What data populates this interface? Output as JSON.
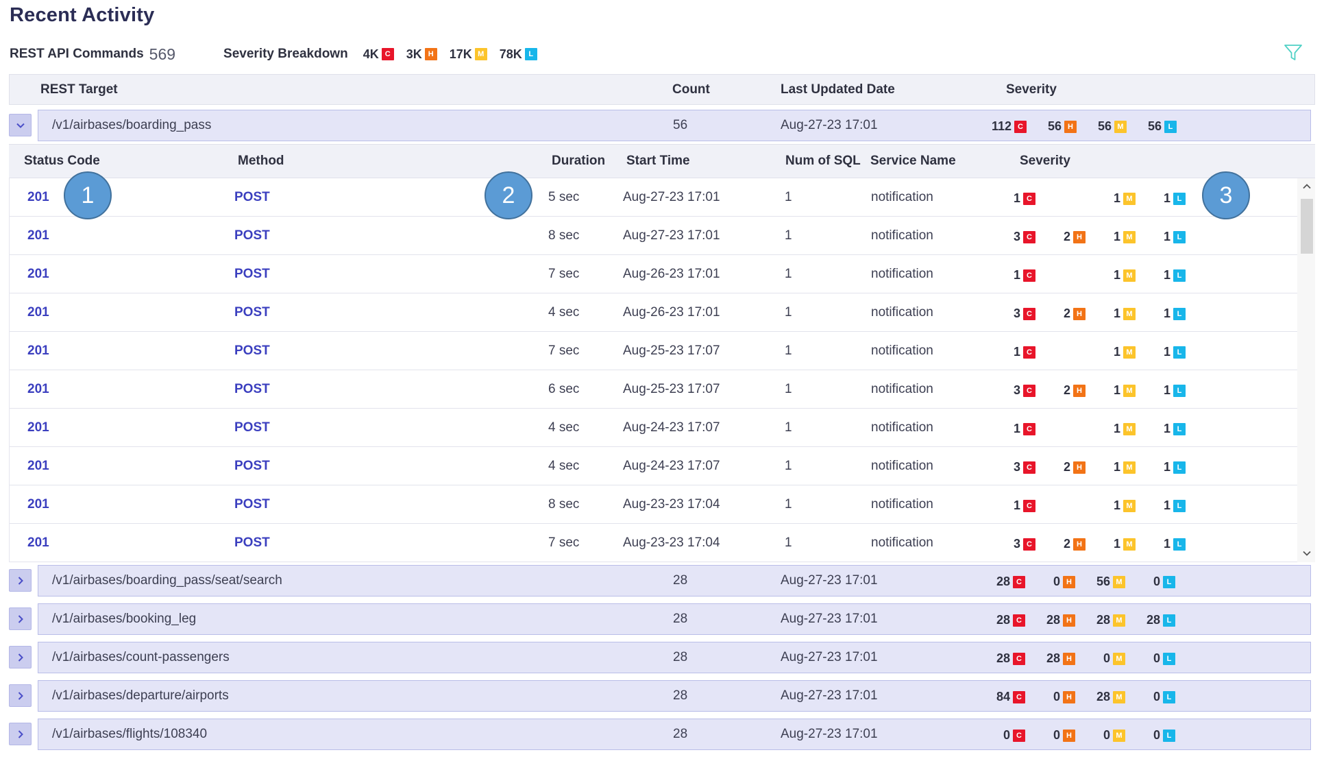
{
  "title": "Recent Activity",
  "summary": {
    "commands_label": "REST API Commands",
    "commands_value": "569",
    "breakdown_label": "Severity Breakdown",
    "breakdown": [
      {
        "value": "4K",
        "badge": "C"
      },
      {
        "value": "3K",
        "badge": "H"
      },
      {
        "value": "17K",
        "badge": "M"
      },
      {
        "value": "78K",
        "badge": "L"
      }
    ]
  },
  "colors": {
    "critical": "#e8152a",
    "high": "#f27316",
    "medium": "#fcc42b",
    "low": "#18b6ea",
    "header_bg": "#f0f1f7",
    "group_bg": "#e4e5f7",
    "link": "#3b3fbf"
  },
  "icons": {
    "filter": "filter-icon",
    "expand": "chevron-right-icon",
    "collapse": "chevron-down-icon"
  },
  "table": {
    "columns": {
      "target": "REST Target",
      "count": "Count",
      "updated": "Last Updated Date",
      "severity": "Severity"
    }
  },
  "expanded_group": {
    "target": "/v1/airbases/boarding_pass",
    "count": "56",
    "updated": "Aug-27-23 17:01",
    "severity": [
      {
        "value": "112",
        "badge": "C"
      },
      {
        "value": "56",
        "badge": "H"
      },
      {
        "value": "56",
        "badge": "M"
      },
      {
        "value": "56",
        "badge": "L"
      }
    ],
    "sub_columns": {
      "status": "Status Code",
      "method": "Method",
      "duration": "Duration",
      "start": "Start Time",
      "sql": "Num of SQL",
      "service": "Service Name",
      "severity": "Severity"
    },
    "rows": [
      {
        "status": "201",
        "method": "POST",
        "duration": "5 sec",
        "start": "Aug-27-23 17:01",
        "sql": "1",
        "service": "notification",
        "severity": [
          {
            "value": "1",
            "badge": "C"
          },
          {
            "value": "1",
            "badge": "M"
          },
          {
            "value": "1",
            "badge": "L"
          }
        ]
      },
      {
        "status": "201",
        "method": "POST",
        "duration": "8 sec",
        "start": "Aug-27-23 17:01",
        "sql": "1",
        "service": "notification",
        "severity": [
          {
            "value": "3",
            "badge": "C"
          },
          {
            "value": "2",
            "badge": "H"
          },
          {
            "value": "1",
            "badge": "M"
          },
          {
            "value": "1",
            "badge": "L"
          }
        ]
      },
      {
        "status": "201",
        "method": "POST",
        "duration": "7 sec",
        "start": "Aug-26-23 17:01",
        "sql": "1",
        "service": "notification",
        "severity": [
          {
            "value": "1",
            "badge": "C"
          },
          {
            "value": "1",
            "badge": "M"
          },
          {
            "value": "1",
            "badge": "L"
          }
        ]
      },
      {
        "status": "201",
        "method": "POST",
        "duration": "4 sec",
        "start": "Aug-26-23 17:01",
        "sql": "1",
        "service": "notification",
        "severity": [
          {
            "value": "3",
            "badge": "C"
          },
          {
            "value": "2",
            "badge": "H"
          },
          {
            "value": "1",
            "badge": "M"
          },
          {
            "value": "1",
            "badge": "L"
          }
        ]
      },
      {
        "status": "201",
        "method": "POST",
        "duration": "7 sec",
        "start": "Aug-25-23 17:07",
        "sql": "1",
        "service": "notification",
        "severity": [
          {
            "value": "1",
            "badge": "C"
          },
          {
            "value": "1",
            "badge": "M"
          },
          {
            "value": "1",
            "badge": "L"
          }
        ]
      },
      {
        "status": "201",
        "method": "POST",
        "duration": "6 sec",
        "start": "Aug-25-23 17:07",
        "sql": "1",
        "service": "notification",
        "severity": [
          {
            "value": "3",
            "badge": "C"
          },
          {
            "value": "2",
            "badge": "H"
          },
          {
            "value": "1",
            "badge": "M"
          },
          {
            "value": "1",
            "badge": "L"
          }
        ]
      },
      {
        "status": "201",
        "method": "POST",
        "duration": "4 sec",
        "start": "Aug-24-23 17:07",
        "sql": "1",
        "service": "notification",
        "severity": [
          {
            "value": "1",
            "badge": "C"
          },
          {
            "value": "1",
            "badge": "M"
          },
          {
            "value": "1",
            "badge": "L"
          }
        ]
      },
      {
        "status": "201",
        "method": "POST",
        "duration": "4 sec",
        "start": "Aug-24-23 17:07",
        "sql": "1",
        "service": "notification",
        "severity": [
          {
            "value": "3",
            "badge": "C"
          },
          {
            "value": "2",
            "badge": "H"
          },
          {
            "value": "1",
            "badge": "M"
          },
          {
            "value": "1",
            "badge": "L"
          }
        ]
      },
      {
        "status": "201",
        "method": "POST",
        "duration": "8 sec",
        "start": "Aug-23-23 17:04",
        "sql": "1",
        "service": "notification",
        "severity": [
          {
            "value": "1",
            "badge": "C"
          },
          {
            "value": "1",
            "badge": "M"
          },
          {
            "value": "1",
            "badge": "L"
          }
        ]
      },
      {
        "status": "201",
        "method": "POST",
        "duration": "7 sec",
        "start": "Aug-23-23 17:04",
        "sql": "1",
        "service": "notification",
        "severity": [
          {
            "value": "3",
            "badge": "C"
          },
          {
            "value": "2",
            "badge": "H"
          },
          {
            "value": "1",
            "badge": "M"
          },
          {
            "value": "1",
            "badge": "L"
          }
        ]
      }
    ]
  },
  "collapsed_groups": [
    {
      "target": "/v1/airbases/boarding_pass/seat/search",
      "count": "28",
      "updated": "Aug-27-23 17:01",
      "severity": [
        {
          "value": "28",
          "badge": "C"
        },
        {
          "value": "0",
          "badge": "H"
        },
        {
          "value": "56",
          "badge": "M"
        },
        {
          "value": "0",
          "badge": "L"
        }
      ]
    },
    {
      "target": "/v1/airbases/booking_leg",
      "count": "28",
      "updated": "Aug-27-23 17:01",
      "severity": [
        {
          "value": "28",
          "badge": "C"
        },
        {
          "value": "28",
          "badge": "H"
        },
        {
          "value": "28",
          "badge": "M"
        },
        {
          "value": "28",
          "badge": "L"
        }
      ]
    },
    {
      "target": "/v1/airbases/count-passengers",
      "count": "28",
      "updated": "Aug-27-23 17:01",
      "severity": [
        {
          "value": "28",
          "badge": "C"
        },
        {
          "value": "28",
          "badge": "H"
        },
        {
          "value": "0",
          "badge": "M"
        },
        {
          "value": "0",
          "badge": "L"
        }
      ]
    },
    {
      "target": "/v1/airbases/departure/airports",
      "count": "28",
      "updated": "Aug-27-23 17:01",
      "severity": [
        {
          "value": "84",
          "badge": "C"
        },
        {
          "value": "0",
          "badge": "H"
        },
        {
          "value": "28",
          "badge": "M"
        },
        {
          "value": "0",
          "badge": "L"
        }
      ]
    },
    {
      "target": "/v1/airbases/flights/108340",
      "count": "28",
      "updated": "Aug-27-23 17:01",
      "severity": [
        {
          "value": "0",
          "badge": "C"
        },
        {
          "value": "0",
          "badge": "H"
        },
        {
          "value": "0",
          "badge": "M"
        },
        {
          "value": "0",
          "badge": "L"
        }
      ]
    }
  ],
  "callouts": [
    "1",
    "2",
    "3"
  ]
}
